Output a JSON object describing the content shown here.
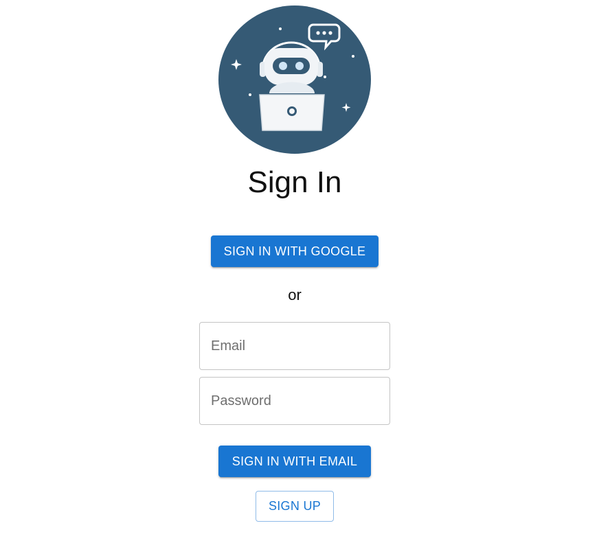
{
  "logo": {
    "icon": "robot-support-agent-icon",
    "background_color": "#355a75"
  },
  "page": {
    "title": "Sign In",
    "divider_text": "or"
  },
  "buttons": {
    "google_label": "SIGN IN WITH GOOGLE",
    "email_label": "SIGN IN WITH EMAIL",
    "signup_label": "SIGN UP",
    "accent_color": "#1976d2"
  },
  "form": {
    "email": {
      "value": "",
      "placeholder": "Email"
    },
    "password": {
      "value": "",
      "placeholder": "Password"
    }
  }
}
